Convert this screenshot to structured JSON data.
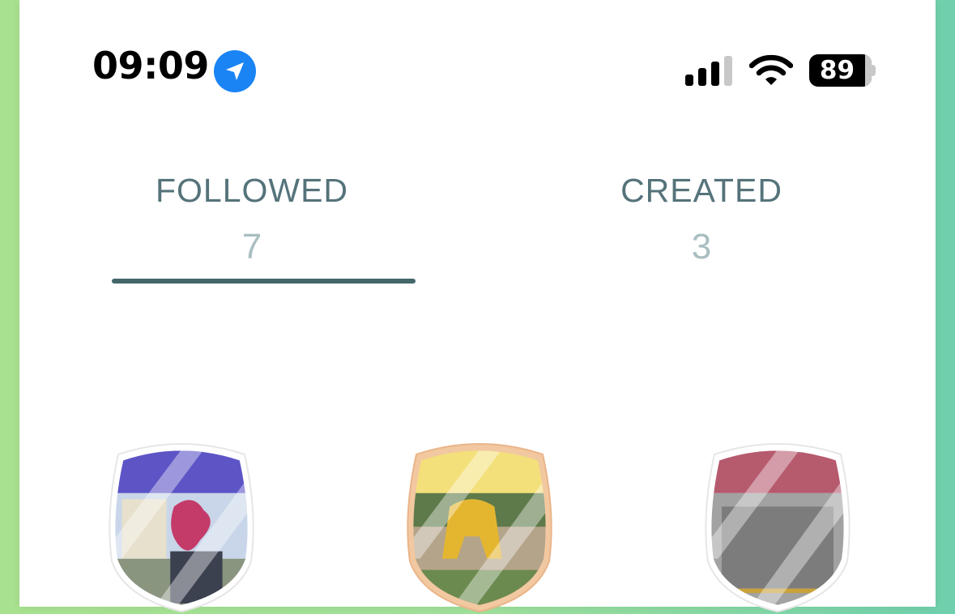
{
  "status_bar": {
    "time": "09:09",
    "location_icon": "location-arrow-icon",
    "signal_icon": "cellular-signal-icon",
    "signal_bars_filled": 3,
    "signal_bars_total": 4,
    "wifi_icon": "wifi-icon",
    "battery_icon": "battery-icon",
    "battery": "89"
  },
  "tabs": [
    {
      "label": "FOLLOWED",
      "count": "7",
      "selected": true
    },
    {
      "label": "CREATED",
      "count": "3",
      "selected": false
    }
  ],
  "routes": [
    {
      "icon": "route-badge-icon",
      "band_color": "#5d54c6",
      "photo_tone": "#c9d6ea",
      "accent": "#c43b6a",
      "border_color": "#ffffff"
    },
    {
      "icon": "route-badge-icon",
      "band_color": "#f3e07a",
      "photo_tone": "#b4a48a",
      "accent": "#e4b630",
      "border_color": "#f2c8a0"
    },
    {
      "icon": "route-badge-icon",
      "band_color": "#b65a6e",
      "photo_tone": "#a2a2a2",
      "accent": "#7c7c7c",
      "border_color": "#ffffff"
    }
  ],
  "colors": {
    "background_left": "#a8e28f",
    "background_right": "#6fd0ad",
    "tab_label": "#55737a",
    "tab_count": "#a9bec0",
    "tab_indicator": "#43676b",
    "location_badge": "#1a84f5"
  }
}
